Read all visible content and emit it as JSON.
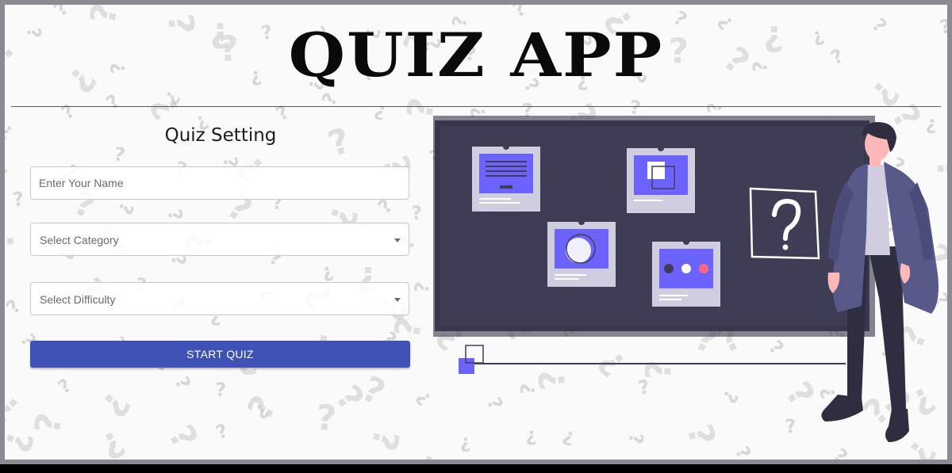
{
  "app": {
    "title": "QUIZ APP"
  },
  "quiz_setting": {
    "heading": "Quiz Setting",
    "name_input": {
      "placeholder": "Enter Your Name",
      "value": ""
    },
    "category_select": {
      "placeholder": "Select Category"
    },
    "difficulty_select": {
      "placeholder": "Select Difficulty"
    },
    "start_button": {
      "label": "START QUIZ"
    }
  },
  "illustration": {
    "icon": "person-at-question-board-illustration",
    "colors": {
      "board": "#3f3d56",
      "accent": "#6c63ff",
      "card": "#d0cde1",
      "coat": "#575a89",
      "skin": "#ffb8b8",
      "dot_red": "#ff6584"
    }
  },
  "colors": {
    "primary_button": "#3f51b5",
    "frame": "#8b8b96",
    "background": "#fafafa"
  }
}
